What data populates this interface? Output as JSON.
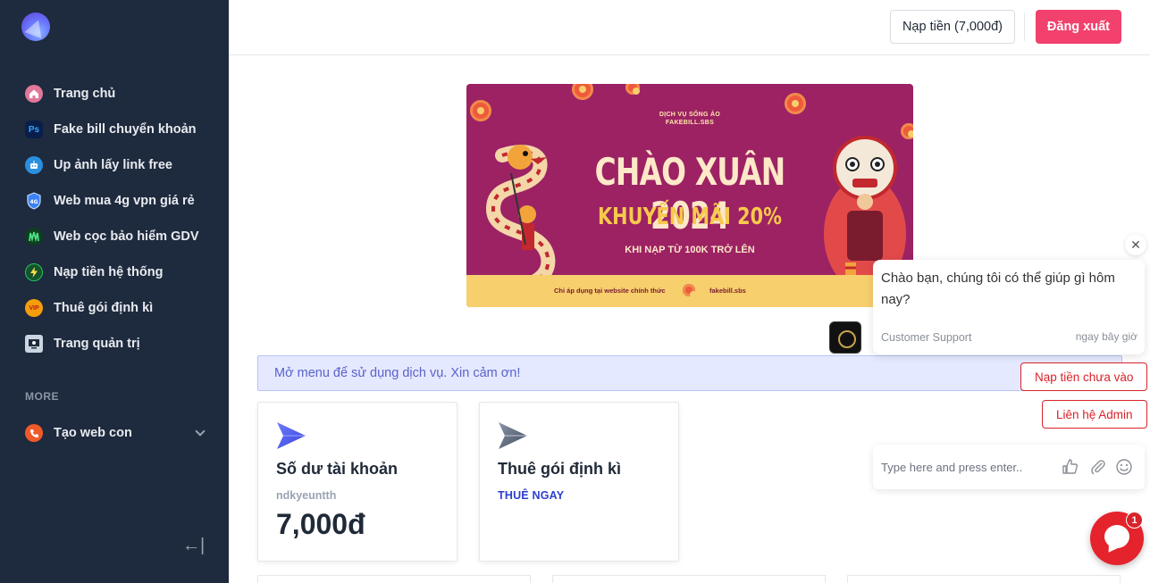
{
  "sidebar": {
    "items": [
      {
        "label": "Trang chủ",
        "icon": "home-icon",
        "color": "#e0789a"
      },
      {
        "label": "Fake bill chuyển khoản",
        "icon": "photoshop-icon",
        "color": "#0a1e4a"
      },
      {
        "label": "Up ảnh lấy link free",
        "icon": "upload-robot-icon",
        "color": "#2b8fe0"
      },
      {
        "label": "Web mua 4g vpn giá rẻ",
        "icon": "shield-icon",
        "color": "#3b82f6"
      },
      {
        "label": "Web cọc bảo hiểm GDV",
        "icon": "monster-icon",
        "color": "#16a34a"
      },
      {
        "label": "Nạp tiền hệ thống",
        "icon": "lightning-icon",
        "color": "#22c55e"
      },
      {
        "label": "Thuê gói định kì",
        "icon": "vip-icon",
        "color": "#f59e0b"
      },
      {
        "label": "Trang quản trị",
        "icon": "admin-icon",
        "color": "#64748b"
      }
    ],
    "more_label": "MORE",
    "more_items": [
      {
        "label": "Tạo web con",
        "icon": "phone-icon",
        "color": "#f05a28"
      }
    ],
    "collapse_symbol": "←|"
  },
  "header": {
    "topup_label": "Nạp tiền (7,000đ)",
    "logout_label": "Đăng xuất"
  },
  "banner": {
    "small_line1": "DỊCH VỤ SỐNG ẢO",
    "small_line2": "FAKEBILL.SBS",
    "title": "CHÀO XUÂN 2024",
    "subtitle": "KHUYẾN MÃI 20%",
    "subtitle2": "KHI NẠP TỪ 100K TRỞ LÊN",
    "foot_left": "Chỉ áp dụng tại website chính thức",
    "foot_right": "fakebill.sbs"
  },
  "notice": "Mở menu để sử dụng dịch vụ. Xin cảm ơn!",
  "cards": [
    {
      "title": "Số dư tài khoản",
      "sub": "ndkyeuntth",
      "value": "7,000đ"
    },
    {
      "title": "Thuê gói định kì",
      "link": "THUÊ NGAY"
    }
  ],
  "chat": {
    "message": "Chào bạn, chúng tôi có thể giúp gì hôm nay?",
    "agent": "Customer Support",
    "time": "ngay bây giờ",
    "options": [
      "Nạp tiền chưa vào",
      "Liên hệ Admin"
    ],
    "input_placeholder": "Type here and press enter..",
    "badge": "1",
    "close_symbol": "✕"
  },
  "colors": {
    "sidebar_bg": "#1e2a3d",
    "logout_bg": "#f1416c",
    "notice_bg": "#e5e9ff",
    "chat_red": "#e5232c"
  }
}
